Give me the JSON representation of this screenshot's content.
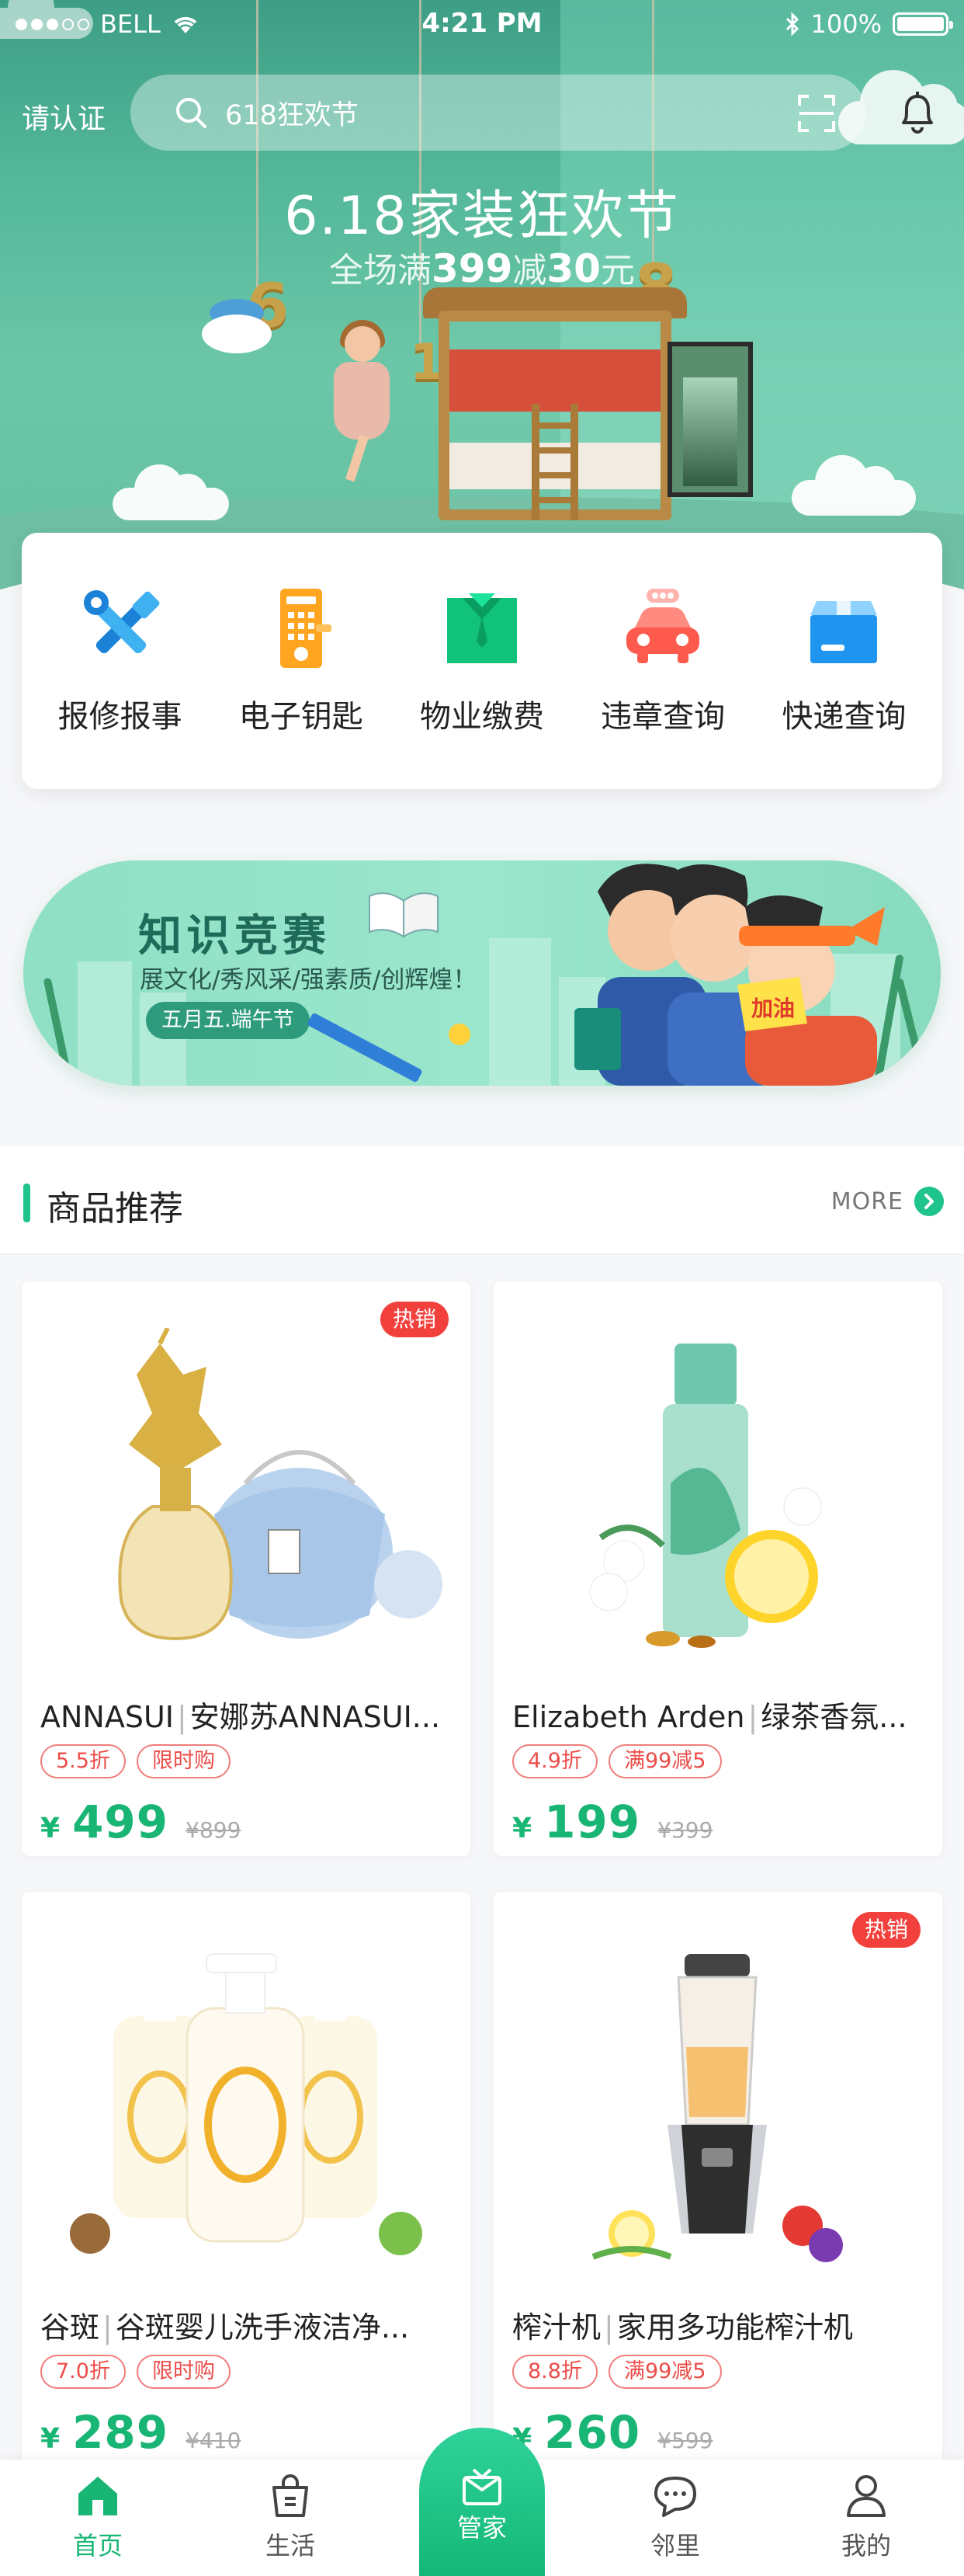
{
  "status_bar": {
    "carrier": "BELL",
    "time": "4:21 PM",
    "battery": "100%",
    "battery_level": 1.0
  },
  "header": {
    "auth_link": "请认证",
    "search_placeholder": "618狂欢节"
  },
  "hero": {
    "title": "6.18家装狂欢节",
    "sub_prefix": "全场满",
    "sub_amount1": "399",
    "sub_mid": "减",
    "sub_amount2": "30",
    "sub_suffix": "元",
    "digits": [
      "6",
      "1",
      "8"
    ]
  },
  "services": [
    {
      "label": "报修报事",
      "icon": "repair-tools-icon"
    },
    {
      "label": "电子钥匙",
      "icon": "electronic-key-icon"
    },
    {
      "label": "物业缴费",
      "icon": "property-fee-icon"
    },
    {
      "label": "违章查询",
      "icon": "traffic-violation-car-icon"
    },
    {
      "label": "快递查询",
      "icon": "express-box-icon"
    }
  ],
  "banner": {
    "title": "知识竞赛",
    "subtitle": "展文化/秀风采/强素质/创辉煌！",
    "tag": "五月五.端午节",
    "sign": "加油"
  },
  "section": {
    "title": "商品推荐",
    "more": "MORE"
  },
  "products": [
    {
      "brand": "ANNASUI",
      "name": "安娜苏ANNASUI...",
      "hot": "热销",
      "tags": [
        "5.5折",
        "限时购"
      ],
      "currency": "¥",
      "price": "499",
      "old_price": "¥899"
    },
    {
      "brand": "Elizabeth Arden",
      "name": "绿茶香氛...",
      "hot": "",
      "tags": [
        "4.9折",
        "满99减5"
      ],
      "currency": "¥",
      "price": "199",
      "old_price": "¥399"
    },
    {
      "brand": "谷斑",
      "name": "谷斑婴儿洗手液洁净...",
      "hot": "",
      "tags": [
        "7.0折",
        "限时购"
      ],
      "currency": "¥",
      "price": "289",
      "old_price": "¥410"
    },
    {
      "brand": "榨汁机",
      "name": "家用多功能榨汁机",
      "hot": "热销",
      "tags": [
        "8.8折",
        "满99减5"
      ],
      "currency": "¥",
      "price": "260",
      "old_price": "¥599"
    }
  ],
  "tabbar": [
    {
      "label": "首页",
      "icon": "home-icon",
      "active": true
    },
    {
      "label": "生活",
      "icon": "shopping-bag-icon",
      "active": false
    },
    {
      "label": "管家",
      "icon": "butler-gift-icon",
      "active": false
    },
    {
      "label": "邻里",
      "icon": "chat-bubble-icon",
      "active": false
    },
    {
      "label": "我的",
      "icon": "user-icon",
      "active": false
    }
  ],
  "colors": {
    "brand_green": "#19b574",
    "hot_red": "#f2413d",
    "tag_red": "#ec4d49",
    "hero_green": "#54b89a"
  }
}
